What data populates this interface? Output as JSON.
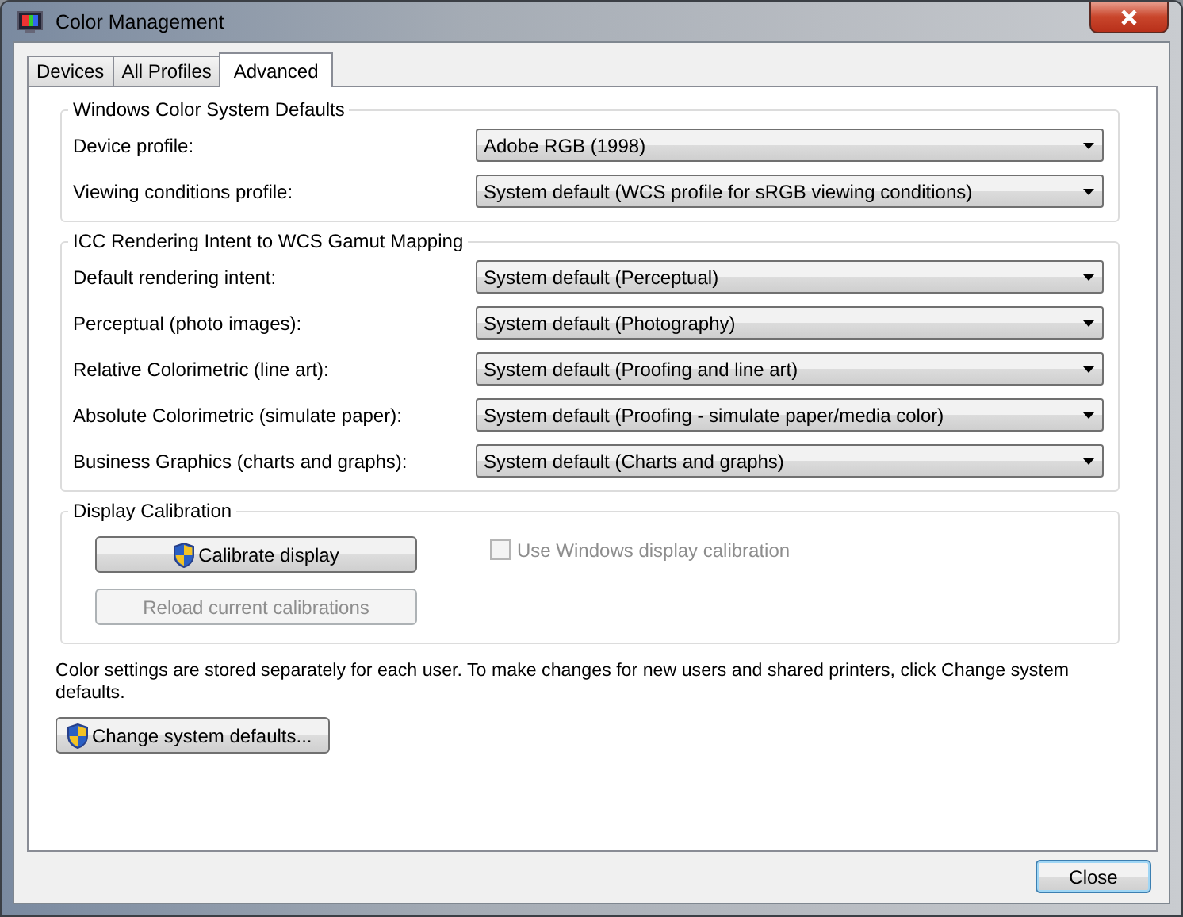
{
  "window": {
    "title": "Color Management"
  },
  "tabs": [
    {
      "label": "Devices",
      "selected": false
    },
    {
      "label": "All Profiles",
      "selected": false
    },
    {
      "label": "Advanced",
      "selected": true
    }
  ],
  "groups": [
    {
      "title": "Windows Color System Defaults",
      "rows": [
        {
          "label": "Device profile:",
          "value": "Adobe RGB (1998)"
        },
        {
          "label": "Viewing conditions profile:",
          "value": "System default (WCS profile for sRGB viewing conditions)"
        }
      ]
    },
    {
      "title": "ICC Rendering Intent to WCS Gamut Mapping",
      "rows": [
        {
          "label": "Default rendering intent:",
          "value": "System default (Perceptual)"
        },
        {
          "label": "Perceptual (photo images):",
          "value": "System default (Photography)"
        },
        {
          "label": "Relative Colorimetric (line art):",
          "value": "System default (Proofing and line art)"
        },
        {
          "label": "Absolute Colorimetric (simulate paper):",
          "value": "System default (Proofing - simulate paper/media color)"
        },
        {
          "label": "Business Graphics (charts and graphs):",
          "value": "System default (Charts and graphs)"
        }
      ]
    }
  ],
  "calibration": {
    "title": "Display Calibration",
    "buttons": [
      {
        "label": "Calibrate display",
        "shield": true,
        "disabled": false
      },
      {
        "label": "Reload current calibrations",
        "shield": false,
        "disabled": true
      }
    ],
    "checkbox": {
      "label": "Use Windows display calibration",
      "checked": false,
      "disabled": true
    }
  },
  "note": "Color settings are stored separately for each user. To make changes for new users and shared printers, click Change system defaults.",
  "change_button": {
    "label": "Change system defaults...",
    "shield": true
  },
  "close_button": {
    "label": "Close"
  }
}
